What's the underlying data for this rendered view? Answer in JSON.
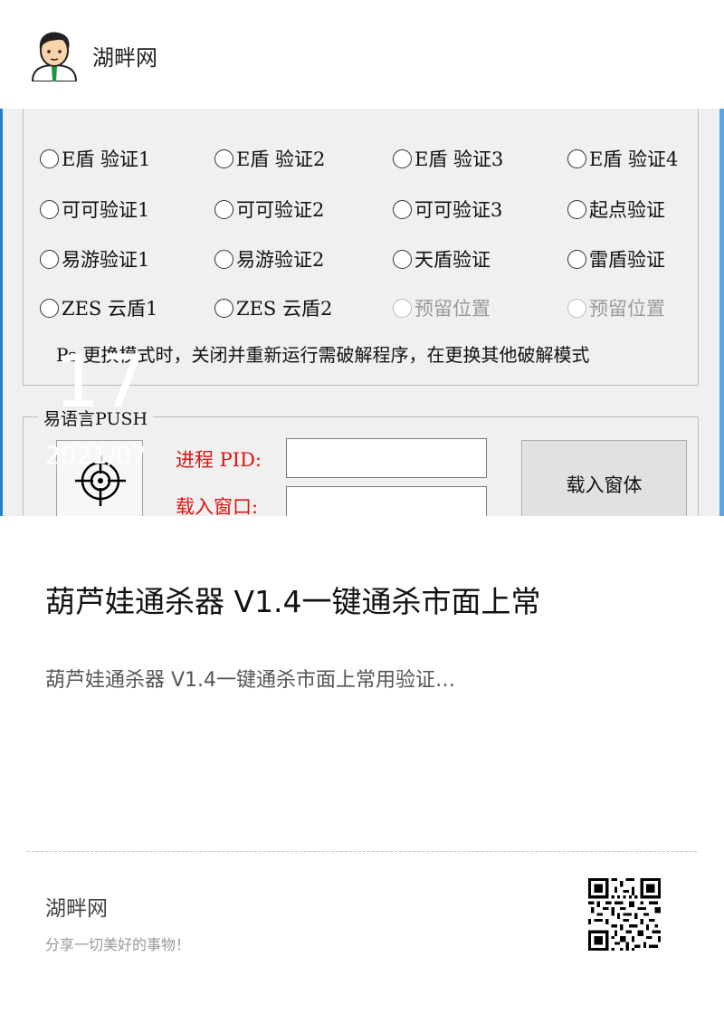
{
  "header": {
    "site_name": "湖畔网",
    "avatar_icon": "cartoon-man-avatar-icon"
  },
  "screenshot": {
    "radios": [
      {
        "label": "E盾 验证1",
        "enabled": true
      },
      {
        "label": "E盾 验证2",
        "enabled": true
      },
      {
        "label": "E盾 验证3",
        "enabled": true
      },
      {
        "label": "E盾 验证4",
        "enabled": true
      },
      {
        "label": "可可验证1",
        "enabled": true
      },
      {
        "label": "可可验证2",
        "enabled": true
      },
      {
        "label": "可可验证3",
        "enabled": true
      },
      {
        "label": "起点验证",
        "enabled": true
      },
      {
        "label": "易游验证1",
        "enabled": true
      },
      {
        "label": "易游验证2",
        "enabled": true
      },
      {
        "label": "天盾验证",
        "enabled": true
      },
      {
        "label": "雷盾验证",
        "enabled": true
      },
      {
        "label": "ZES 云盾1",
        "enabled": true
      },
      {
        "label": "ZES 云盾2",
        "enabled": true
      },
      {
        "label": "预留位置",
        "enabled": false
      },
      {
        "label": "预留位置",
        "enabled": false
      }
    ],
    "note": "Ps.更换模式时，关闭并重新运行需破解程序，在更换其他破解模式",
    "group_title": "易语言PUSH",
    "pid_label": "进程 PID:",
    "window_label": "载入窗口:",
    "load_button": "载入窗体",
    "target_icon": "crosshair-icon"
  },
  "date": {
    "day": "17",
    "year_month": "2021/07"
  },
  "post": {
    "title": "葫芦娃通杀器 V1.4一键通杀市面上常",
    "description": "葫芦娃通杀器 V1.4一键通杀市面上常用验证…"
  },
  "footer": {
    "site_name": "湖畔网",
    "slogan": "分享一切美好的事物！",
    "qr_icon": "qr-code-icon"
  }
}
